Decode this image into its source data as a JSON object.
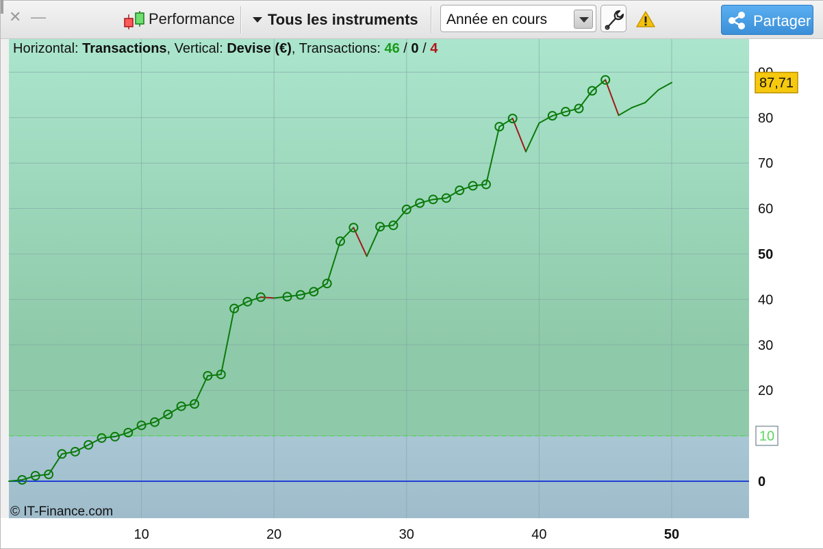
{
  "toolbar": {
    "close_glyph": "✕",
    "min_glyph": "—",
    "performance_label": "Performance",
    "performance_icon": "candlestick-icon",
    "instruments_label": "Tous les instruments",
    "period_value": "Année en cours",
    "wrench_icon": "wrench-icon",
    "warning_icon": "warning-icon",
    "share_label": "Partager",
    "share_icon": "share-icon"
  },
  "header": {
    "h_label": "Horizontal: ",
    "h_value": "Transactions",
    "v_label": ", Vertical: ",
    "v_value": "Devise (€)",
    "t_label": ", Transactions: ",
    "t_win": "46",
    "t_sep1": " / ",
    "t_even": "0",
    "t_sep2": " / ",
    "t_loss": "4"
  },
  "copyright": "© IT-Finance.com",
  "colors": {
    "up_line": "#0a7a0a",
    "down_line": "#a01818",
    "zero_line": "#1f3fd6",
    "threshold": "#5cd65c",
    "last_badge": "#f6c90e",
    "bg_top": "#a8e4cb",
    "bg_mid": "#8cc9a8",
    "bg_low": "#a3c0d0",
    "share_bg": "#3d93dc"
  },
  "chart_data": {
    "type": "line",
    "xlabel": "Transactions",
    "ylabel": "Devise (€)",
    "xlim": [
      0,
      56
    ],
    "ylim": [
      -8,
      96
    ],
    "x_ticks": [
      10,
      20,
      30,
      40,
      50
    ],
    "x_ticks_bold": [
      50
    ],
    "y_ticks": [
      0,
      10,
      20,
      30,
      40,
      50,
      60,
      70,
      80,
      90
    ],
    "y_ticks_bold": [
      0,
      50
    ],
    "threshold": {
      "value": 10,
      "label": "10"
    },
    "last_value": {
      "value": 87.71,
      "label": "87,71"
    },
    "grid": true,
    "series": [
      {
        "x": [
          0,
          1,
          2,
          3,
          4,
          5,
          6,
          7,
          8,
          9,
          10,
          11,
          12,
          13,
          14,
          15,
          16,
          17,
          18,
          19,
          20,
          21,
          22,
          23,
          24,
          25,
          26,
          27,
          28,
          29,
          30,
          31,
          32,
          33,
          34,
          35,
          36,
          37,
          38,
          39,
          40,
          41,
          42,
          43,
          44,
          45,
          46,
          47,
          48,
          49,
          50
        ],
        "y": [
          0,
          0.3,
          1.2,
          1.5,
          6.0,
          6.5,
          8.0,
          9.5,
          9.8,
          10.7,
          12.3,
          13.0,
          14.7,
          16.5,
          17.0,
          23.2,
          23.5,
          38.0,
          39.5,
          40.5,
          40.3,
          40.6,
          41.0,
          41.7,
          43.5,
          52.8,
          55.8,
          49.5,
          56.0,
          56.3,
          59.8,
          61.2,
          62.0,
          62.3,
          64.0,
          65.0,
          65.3,
          78.0,
          79.8,
          72.5,
          78.8,
          80.4,
          81.3,
          82.0,
          85.9,
          88.3,
          80.5,
          82.2,
          83.3,
          86.1,
          87.71
        ]
      }
    ],
    "markers_x": [
      1,
      2,
      3,
      4,
      5,
      6,
      7,
      8,
      9,
      10,
      11,
      12,
      13,
      14,
      15,
      16,
      17,
      18,
      19,
      21,
      22,
      23,
      24,
      25,
      26,
      28,
      29,
      30,
      31,
      32,
      33,
      34,
      35,
      36,
      37,
      38,
      41,
      42,
      43,
      44,
      45
    ],
    "down_segments": [
      [
        19,
        20
      ],
      [
        26,
        27
      ],
      [
        38,
        39
      ],
      [
        45,
        46
      ]
    ]
  }
}
